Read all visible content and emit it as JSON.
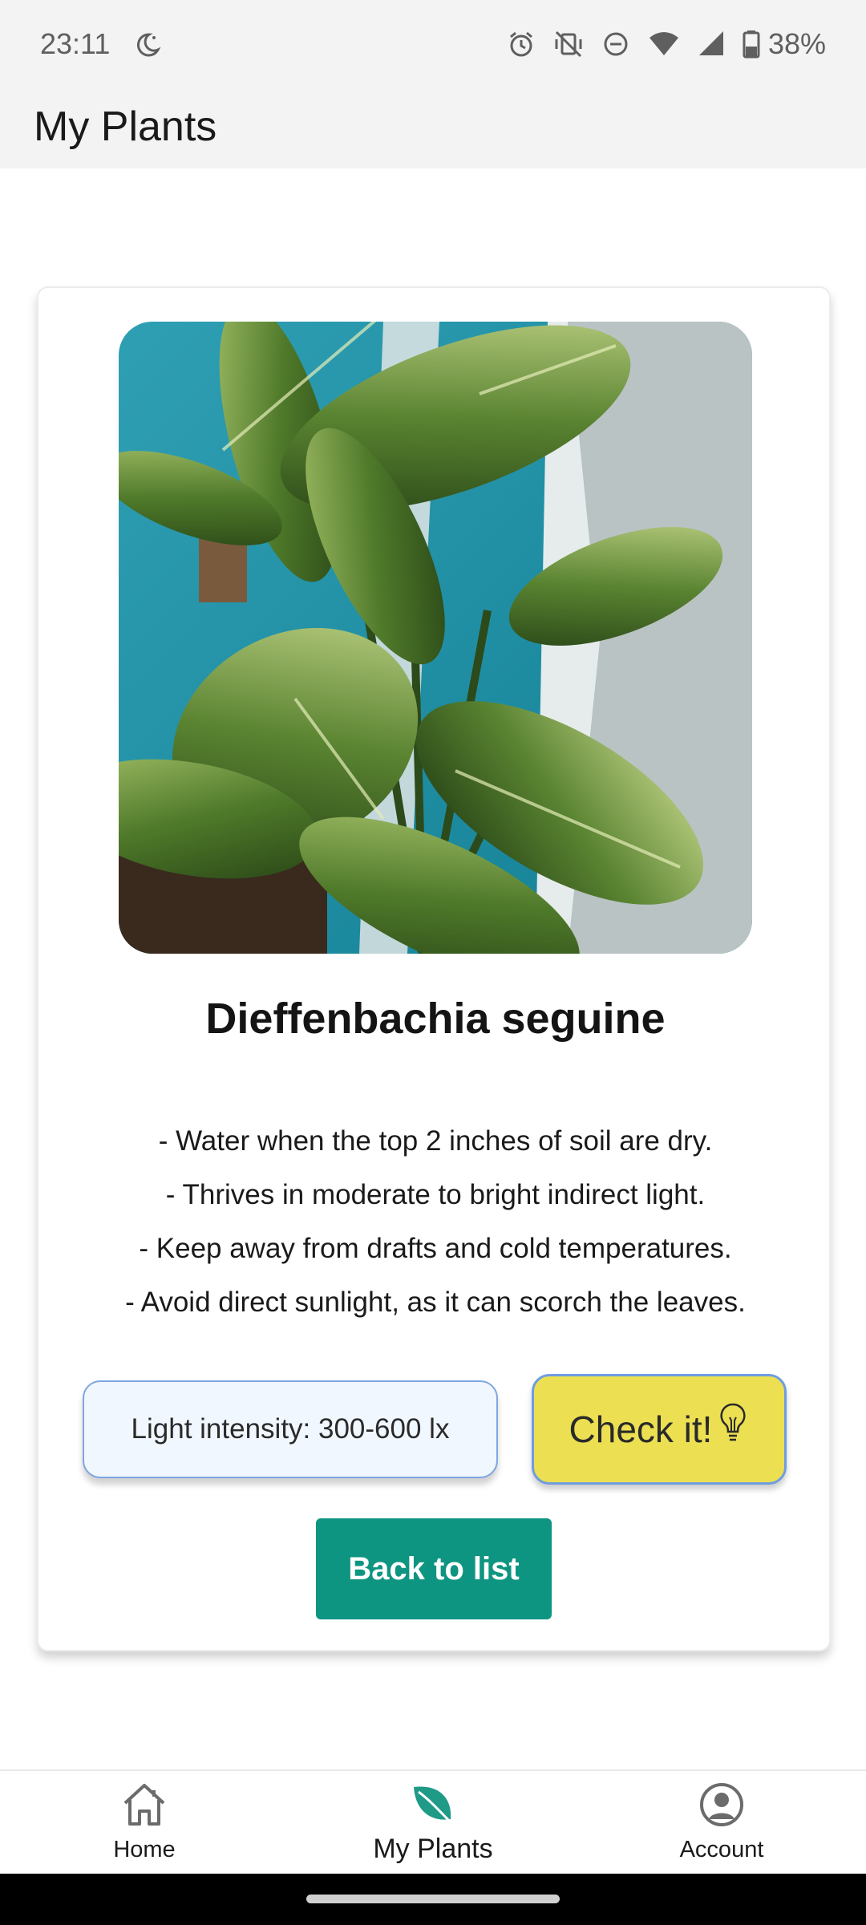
{
  "status_bar": {
    "time": "23:11",
    "battery": "38%",
    "icons": [
      "moon-icon",
      "alarm-icon",
      "vibrate-off-icon",
      "do-not-disturb-icon",
      "wifi-icon",
      "signal-icon",
      "battery-icon"
    ]
  },
  "app_bar": {
    "title": "My Plants"
  },
  "plant": {
    "name": "Dieffenbachia seguine",
    "care": [
      "- Water when the top 2 inches of soil are dry.",
      "- Thrives in moderate to bright indirect light.",
      "- Keep away from drafts and cold temperatures.",
      "- Avoid direct sunlight, as it can scorch the leaves."
    ],
    "light_intensity": "Light intensity: 300-600 lx",
    "check_label": "Check it!",
    "back_label": "Back to list"
  },
  "bottom_nav": {
    "items": [
      {
        "label": "Home",
        "icon": "home-icon"
      },
      {
        "label": "My Plants",
        "icon": "leaf-icon",
        "active": true
      },
      {
        "label": "Account",
        "icon": "account-icon"
      }
    ]
  },
  "colors": {
    "accent": "#0e9582",
    "check_button": "#ece052",
    "light_box_bg": "#f1f7ff",
    "light_box_border": "#7ea6e0",
    "bar_bg": "#f3f3f3"
  }
}
